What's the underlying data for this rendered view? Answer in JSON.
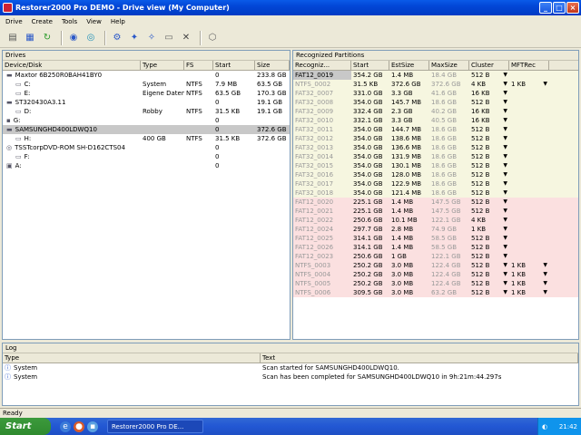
{
  "window": {
    "title": "Restorer2000 Pro DEMO - Drive view (My Computer)",
    "icon": "app-icon",
    "buttons": [
      "minimize-icon",
      "maximize-icon",
      "close-icon"
    ]
  },
  "menu": [
    "Drive",
    "Create",
    "Tools",
    "View",
    "Help"
  ],
  "toolbar": {
    "icons": [
      "drive-icon",
      "network-drive-icon",
      "refresh-icon",
      "disk-image-icon",
      "scan-icon",
      "gear-icon",
      "tool-a-icon",
      "tool-b-icon",
      "disk-icon",
      "delete-icon",
      "settings-icon"
    ]
  },
  "drives": {
    "title": "Drives",
    "columns": [
      "Device/Disk",
      "Type",
      "FS",
      "Start",
      "Size"
    ],
    "rows": [
      {
        "indent": 0,
        "icon": "hdd-icon",
        "name": "Maxtor 6B250R0BAH41BY0",
        "type": "",
        "fs": "",
        "start": "0",
        "size": "233.8 GB",
        "selected": false
      },
      {
        "indent": 1,
        "icon": "partition-icon",
        "name": "C:",
        "type": "System",
        "fs": "NTFS",
        "start": "7.9 MB",
        "size": "63.5 GB",
        "selected": false
      },
      {
        "indent": 1,
        "icon": "partition-icon",
        "name": "E:",
        "type": "Eigene Daten",
        "fs": "NTFS",
        "start": "63.5 GB",
        "size": "170.3 GB",
        "selected": false
      },
      {
        "indent": 0,
        "icon": "hdd-icon",
        "name": "ST320430A3.11",
        "type": "",
        "fs": "",
        "start": "0",
        "size": "19.1 GB",
        "selected": false
      },
      {
        "indent": 1,
        "icon": "partition-icon",
        "name": "D:",
        "type": "Robby",
        "fs": "NTFS",
        "start": "31.5 KB",
        "size": "19.1 GB",
        "selected": false
      },
      {
        "indent": 0,
        "icon": "drive-icon",
        "name": "G:",
        "type": "",
        "fs": "",
        "start": "0",
        "size": "",
        "selected": false
      },
      {
        "indent": 0,
        "icon": "hdd-icon",
        "name": "SAMSUNGHD400LDWQ10",
        "type": "",
        "fs": "",
        "start": "0",
        "size": "372.6 GB",
        "selected": true
      },
      {
        "indent": 1,
        "icon": "partition-icon",
        "name": "H:",
        "type": "400 GB",
        "fs": "NTFS",
        "start": "31.5 KB",
        "size": "372.6 GB",
        "selected": false
      },
      {
        "indent": 0,
        "icon": "cdrom-icon",
        "name": "TSSTcorpDVD-ROM SH-D162CTS04",
        "type": "",
        "fs": "",
        "start": "0",
        "size": "",
        "selected": false
      },
      {
        "indent": 1,
        "icon": "partition-icon",
        "name": "F:",
        "type": "",
        "fs": "",
        "start": "0",
        "size": "",
        "selected": false
      },
      {
        "indent": 0,
        "icon": "floppy-icon",
        "name": "A:",
        "type": "",
        "fs": "",
        "start": "0",
        "size": "",
        "selected": false
      }
    ]
  },
  "partitions": {
    "title": "Recognized Partitions",
    "columns": [
      "Recogniz...",
      "Start",
      "EstSize",
      "MaxSize",
      "Cluster",
      "MFTRec"
    ],
    "rows": [
      {
        "name": "FAT12_0019",
        "start": "354.2 GB",
        "est": "1.4 MB",
        "max": "18.4 GB",
        "cluster": "512 B",
        "mft": "",
        "color": "#f6f6e0",
        "hl": true
      },
      {
        "name": "NTFS_0002",
        "start": "31.5 KB",
        "est": "372.6 GB",
        "max": "372.6 GB",
        "cluster": "4 KB",
        "mft": "1 KB",
        "color": "#f6f6e0",
        "hl": false
      },
      {
        "name": "FAT32_0007",
        "start": "331.0 GB",
        "est": "3.3 GB",
        "max": "41.6 GB",
        "cluster": "16 KB",
        "mft": "",
        "color": "#f6f6e0",
        "hl": false
      },
      {
        "name": "FAT32_0008",
        "start": "354.0 GB",
        "est": "145.7 MB",
        "max": "18.6 GB",
        "cluster": "512 B",
        "mft": "",
        "color": "#f6f6e0",
        "hl": false
      },
      {
        "name": "FAT32_0009",
        "start": "332.4 GB",
        "est": "2.3 GB",
        "max": "40.2 GB",
        "cluster": "16 KB",
        "mft": "",
        "color": "#f6f6e0",
        "hl": false
      },
      {
        "name": "FAT32_0010",
        "start": "332.1 GB",
        "est": "3.3 GB",
        "max": "40.5 GB",
        "cluster": "16 KB",
        "mft": "",
        "color": "#f6f6e0",
        "hl": false
      },
      {
        "name": "FAT32_0011",
        "start": "354.0 GB",
        "est": "144.7 MB",
        "max": "18.6 GB",
        "cluster": "512 B",
        "mft": "",
        "color": "#f6f6e0",
        "hl": false
      },
      {
        "name": "FAT32_0012",
        "start": "354.0 GB",
        "est": "138.6 MB",
        "max": "18.6 GB",
        "cluster": "512 B",
        "mft": "",
        "color": "#f6f6e0",
        "hl": false
      },
      {
        "name": "FAT32_0013",
        "start": "354.0 GB",
        "est": "136.6 MB",
        "max": "18.6 GB",
        "cluster": "512 B",
        "mft": "",
        "color": "#f6f6e0",
        "hl": false
      },
      {
        "name": "FAT32_0014",
        "start": "354.0 GB",
        "est": "131.9 MB",
        "max": "18.6 GB",
        "cluster": "512 B",
        "mft": "",
        "color": "#f6f6e0",
        "hl": false
      },
      {
        "name": "FAT32_0015",
        "start": "354.0 GB",
        "est": "130.1 MB",
        "max": "18.6 GB",
        "cluster": "512 B",
        "mft": "",
        "color": "#f6f6e0",
        "hl": false
      },
      {
        "name": "FAT32_0016",
        "start": "354.0 GB",
        "est": "128.0 MB",
        "max": "18.6 GB",
        "cluster": "512 B",
        "mft": "",
        "color": "#f6f6e0",
        "hl": false
      },
      {
        "name": "FAT32_0017",
        "start": "354.0 GB",
        "est": "122.9 MB",
        "max": "18.6 GB",
        "cluster": "512 B",
        "mft": "",
        "color": "#f6f6e0",
        "hl": false
      },
      {
        "name": "FAT32_0018",
        "start": "354.0 GB",
        "est": "121.4 MB",
        "max": "18.6 GB",
        "cluster": "512 B",
        "mft": "",
        "color": "#f6f6e0",
        "hl": false
      },
      {
        "name": "FAT12_0020",
        "start": "225.1 GB",
        "est": "1.4 MB",
        "max": "147.5 GB",
        "cluster": "512 B",
        "mft": "",
        "color": "#fbe0e0",
        "hl": false
      },
      {
        "name": "FAT12_0021",
        "start": "225.1 GB",
        "est": "1.4 MB",
        "max": "147.5 GB",
        "cluster": "512 B",
        "mft": "",
        "color": "#fbe0e0",
        "hl": false
      },
      {
        "name": "FAT12_0022",
        "start": "250.6 GB",
        "est": "10.1 MB",
        "max": "122.1 GB",
        "cluster": "4 KB",
        "mft": "",
        "color": "#fbe0e0",
        "hl": false
      },
      {
        "name": "FAT12_0024",
        "start": "297.7 GB",
        "est": "2.8 MB",
        "max": "74.9 GB",
        "cluster": "1 KB",
        "mft": "",
        "color": "#fbe0e0",
        "hl": false
      },
      {
        "name": "FAT12_0025",
        "start": "314.1 GB",
        "est": "1.4 MB",
        "max": "58.5 GB",
        "cluster": "512 B",
        "mft": "",
        "color": "#fbe0e0",
        "hl": false
      },
      {
        "name": "FAT12_0026",
        "start": "314.1 GB",
        "est": "1.4 MB",
        "max": "58.5 GB",
        "cluster": "512 B",
        "mft": "",
        "color": "#fbe0e0",
        "hl": false
      },
      {
        "name": "FAT12_0023",
        "start": "250.6 GB",
        "est": "1 GB",
        "max": "122.1 GB",
        "cluster": "512 B",
        "mft": "",
        "color": "#fbe0e0",
        "hl": false
      },
      {
        "name": "NTFS_0003",
        "start": "250.2 GB",
        "est": "3.0 MB",
        "max": "122.4 GB",
        "cluster": "512 B",
        "mft": "1 KB",
        "color": "#fbe0e0",
        "hl": false
      },
      {
        "name": "NTFS_0004",
        "start": "250.2 GB",
        "est": "3.0 MB",
        "max": "122.4 GB",
        "cluster": "512 B",
        "mft": "1 KB",
        "color": "#fbe0e0",
        "hl": false
      },
      {
        "name": "NTFS_0005",
        "start": "250.2 GB",
        "est": "3.0 MB",
        "max": "122.4 GB",
        "cluster": "512 B",
        "mft": "1 KB",
        "color": "#fbe0e0",
        "hl": false
      },
      {
        "name": "NTFS_0006",
        "start": "309.5 GB",
        "est": "3.0 MB",
        "max": "63.2 GB",
        "cluster": "512 B",
        "mft": "1 KB",
        "color": "#fbe0e0",
        "hl": false
      }
    ]
  },
  "log": {
    "title": "Log",
    "columns": [
      "Type",
      "Text"
    ],
    "rows": [
      {
        "type": "System",
        "text": "Scan started for SAMSUNGHD400LDWQ10."
      },
      {
        "type": "System",
        "text": "Scan has been completed for SAMSUNGHD400LDWQ10 in 9h:21m:44.297s"
      }
    ]
  },
  "status": "Ready",
  "taskbar": {
    "start": "Start",
    "task": "Restorer2000 Pro DE...",
    "clock": "21:42"
  }
}
